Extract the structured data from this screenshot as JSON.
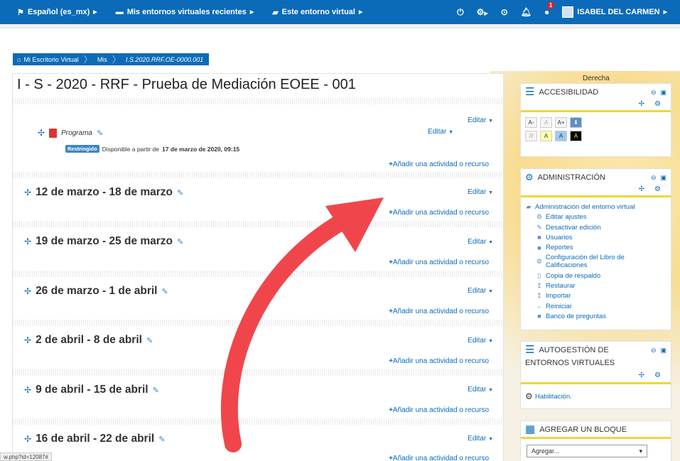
{
  "navbar": {
    "language": "Español (es_mx)",
    "recent": "Mis entornos virtuales recientes",
    "this_env": "Este entorno virtual",
    "notif_count": "1",
    "user_name": "ISABEL DEL CARMEN"
  },
  "breadcrumb": {
    "home": "Mi Escritorio Virtual",
    "mine": "Mis",
    "current": "I.S.2020.RRF.OE-0000.001"
  },
  "course": {
    "title": "I - S - 2020 - RRF - Prueba de Mediación EOEE - 001",
    "edit_label": "Editar",
    "add_label": "Añadir una actividad o recurso",
    "activity": {
      "name": "Programa",
      "restricted_badge": "Restringido",
      "restricted_text": "Disponible a partir de",
      "restricted_date": "17 de marzo de 2020, 09:15"
    },
    "weeks": [
      "12 de marzo - 18 de marzo",
      "19 de marzo - 25 de marzo",
      "26 de marzo - 1 de abril",
      "2 de abril - 8 de abril",
      "9 de abril - 15 de abril",
      "16 de abril - 22 de abril"
    ]
  },
  "sidebar": {
    "region_label": "Derecha",
    "accessibility": {
      "title": "ACCESIBILIDAD",
      "row1": [
        "A-",
        "A",
        "A+"
      ],
      "row2": [
        "R",
        "A",
        "A",
        "A"
      ]
    },
    "admin": {
      "title": "ADMINISTRACIÓN",
      "top": "Administración del entorno virtual",
      "items": [
        "Editar ajustes",
        "Desactivar edición",
        "Usuarios",
        "Reportes",
        "Configuración del Libro de Calificaciones",
        "Copia de respaldo",
        "Restaurar",
        "Importar",
        "Reiniciar",
        "Banco de preguntas"
      ]
    },
    "self_mgmt": {
      "title_line1": "AUTOGESTIÓN DE",
      "title_line2": "ENTORNOS VIRTUALES",
      "item": "Habilitación."
    },
    "add_block": {
      "title": "AGREGAR UN BLOQUE",
      "select_value": "Agregar..."
    }
  },
  "status_url": "w.php?id=12087#",
  "colors": {
    "primary": "#0b6bb8",
    "accent_yellow": "#f2d53c",
    "arrow_red": "#f0464b"
  }
}
